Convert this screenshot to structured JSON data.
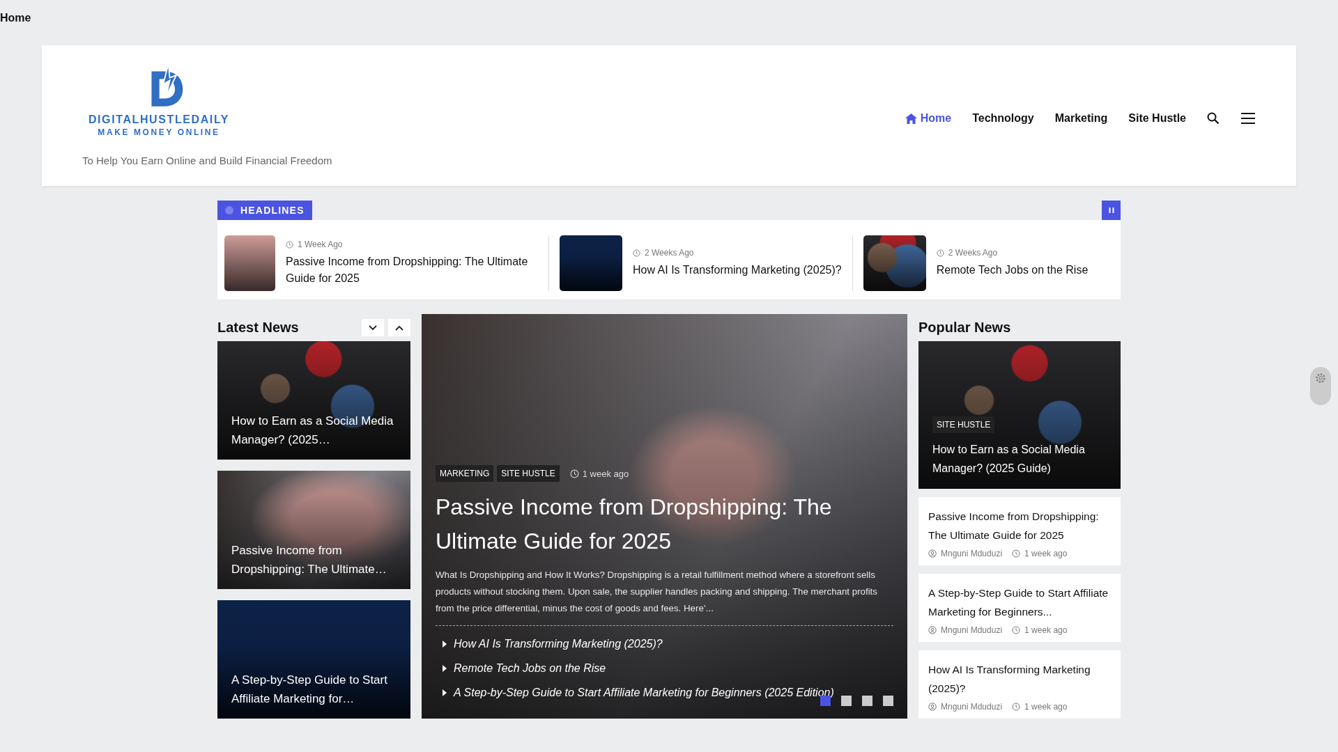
{
  "breadcrumb": "Home",
  "site": {
    "logo_name": "DIGITALHUSTLEDAILY",
    "logo_tagline": "MAKE MONEY ONLINE",
    "description": "To Help You Earn Online and Build Financial Freedom"
  },
  "nav": [
    {
      "label": "Home",
      "selected": true
    },
    {
      "label": "Technology",
      "selected": false
    },
    {
      "label": "Marketing",
      "selected": false
    },
    {
      "label": "Site Hustle",
      "selected": false
    }
  ],
  "headlines": {
    "label": "HEADLINES",
    "items": [
      {
        "time": "1 Week Ago",
        "title": "Passive Income from Dropshipping: The Ultimate Guide for 2025"
      },
      {
        "time": "2 Weeks Ago",
        "title": "How AI Is Transforming Marketing (2025)?"
      },
      {
        "time": "2 Weeks Ago",
        "title": "Remote Tech Jobs on the Rise"
      }
    ]
  },
  "latest_news": {
    "title": "Latest News",
    "items": [
      {
        "title": "How to Earn as a Social Media Manager? (2025…"
      },
      {
        "title": "Passive Income from Dropshipping: The Ultimate…"
      },
      {
        "title": "A Step-by-Step Guide to Start Affiliate Marketing for…"
      }
    ]
  },
  "featured": {
    "categories": [
      "MARKETING",
      "SITE HUSTLE"
    ],
    "time": "1 week ago",
    "title": "Passive Income from Dropshipping: The Ultimate Guide for 2025",
    "excerpt": "What Is Dropshipping and How It Works? Dropshipping is a retail fulfillment method where a storefront sells products without stocking them. Upon sale, the supplier handles packing and shipping. The merchant profits from the price differential, minus the cost of goods and fees. Here’...",
    "related": [
      "How AI Is Transforming Marketing (2025)?",
      "Remote Tech Jobs on the Rise",
      "A Step-by-Step Guide to Start Affiliate Marketing for Beginners (2025 Edition)"
    ],
    "slides": [
      {
        "selected": true
      },
      {
        "selected": false
      },
      {
        "selected": false
      },
      {
        "selected": false
      }
    ]
  },
  "popular_news": {
    "title": "Popular News",
    "top": {
      "category": "SITE HUSTLE",
      "title": "How to Earn as a Social Media Manager? (2025 Guide)"
    },
    "items": [
      {
        "title": "Passive Income from Dropshipping: The Ultimate Guide for 2025",
        "author": "Mnguni Mduduzi",
        "time": "1 week ago"
      },
      {
        "title": "A Step-by-Step Guide to Start Affiliate Marketing for Beginners...",
        "author": "Mnguni Mduduzi",
        "time": "1 week ago"
      },
      {
        "title": "How AI Is Transforming Marketing (2025)?",
        "author": "Mnguni Mduduzi",
        "time": "1 week ago"
      }
    ]
  }
}
